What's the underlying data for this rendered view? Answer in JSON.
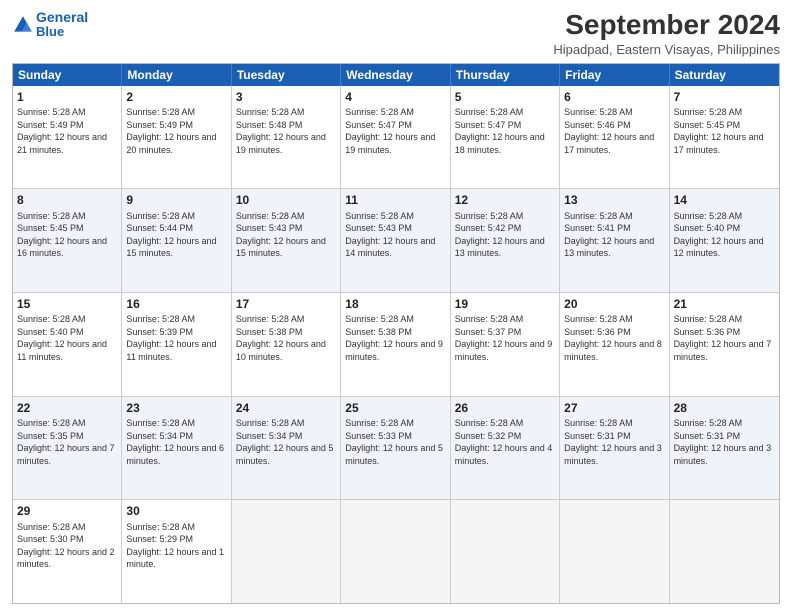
{
  "header": {
    "logo_general": "General",
    "logo_blue": "Blue",
    "title": "September 2024",
    "subtitle": "Hipadpad, Eastern Visayas, Philippines"
  },
  "calendar": {
    "headers": [
      "Sunday",
      "Monday",
      "Tuesday",
      "Wednesday",
      "Thursday",
      "Friday",
      "Saturday"
    ],
    "rows": [
      [
        {
          "day": "1",
          "sunrise": "5:28 AM",
          "sunset": "5:49 PM",
          "daylight": "12 hours and 21 minutes."
        },
        {
          "day": "2",
          "sunrise": "5:28 AM",
          "sunset": "5:49 PM",
          "daylight": "12 hours and 20 minutes."
        },
        {
          "day": "3",
          "sunrise": "5:28 AM",
          "sunset": "5:48 PM",
          "daylight": "12 hours and 19 minutes."
        },
        {
          "day": "4",
          "sunrise": "5:28 AM",
          "sunset": "5:47 PM",
          "daylight": "12 hours and 19 minutes."
        },
        {
          "day": "5",
          "sunrise": "5:28 AM",
          "sunset": "5:47 PM",
          "daylight": "12 hours and 18 minutes."
        },
        {
          "day": "6",
          "sunrise": "5:28 AM",
          "sunset": "5:46 PM",
          "daylight": "12 hours and 17 minutes."
        },
        {
          "day": "7",
          "sunrise": "5:28 AM",
          "sunset": "5:45 PM",
          "daylight": "12 hours and 17 minutes."
        }
      ],
      [
        {
          "day": "8",
          "sunrise": "5:28 AM",
          "sunset": "5:45 PM",
          "daylight": "12 hours and 16 minutes."
        },
        {
          "day": "9",
          "sunrise": "5:28 AM",
          "sunset": "5:44 PM",
          "daylight": "12 hours and 15 minutes."
        },
        {
          "day": "10",
          "sunrise": "5:28 AM",
          "sunset": "5:43 PM",
          "daylight": "12 hours and 15 minutes."
        },
        {
          "day": "11",
          "sunrise": "5:28 AM",
          "sunset": "5:43 PM",
          "daylight": "12 hours and 14 minutes."
        },
        {
          "day": "12",
          "sunrise": "5:28 AM",
          "sunset": "5:42 PM",
          "daylight": "12 hours and 13 minutes."
        },
        {
          "day": "13",
          "sunrise": "5:28 AM",
          "sunset": "5:41 PM",
          "daylight": "12 hours and 13 minutes."
        },
        {
          "day": "14",
          "sunrise": "5:28 AM",
          "sunset": "5:40 PM",
          "daylight": "12 hours and 12 minutes."
        }
      ],
      [
        {
          "day": "15",
          "sunrise": "5:28 AM",
          "sunset": "5:40 PM",
          "daylight": "12 hours and 11 minutes."
        },
        {
          "day": "16",
          "sunrise": "5:28 AM",
          "sunset": "5:39 PM",
          "daylight": "12 hours and 11 minutes."
        },
        {
          "day": "17",
          "sunrise": "5:28 AM",
          "sunset": "5:38 PM",
          "daylight": "12 hours and 10 minutes."
        },
        {
          "day": "18",
          "sunrise": "5:28 AM",
          "sunset": "5:38 PM",
          "daylight": "12 hours and 9 minutes."
        },
        {
          "day": "19",
          "sunrise": "5:28 AM",
          "sunset": "5:37 PM",
          "daylight": "12 hours and 9 minutes."
        },
        {
          "day": "20",
          "sunrise": "5:28 AM",
          "sunset": "5:36 PM",
          "daylight": "12 hours and 8 minutes."
        },
        {
          "day": "21",
          "sunrise": "5:28 AM",
          "sunset": "5:36 PM",
          "daylight": "12 hours and 7 minutes."
        }
      ],
      [
        {
          "day": "22",
          "sunrise": "5:28 AM",
          "sunset": "5:35 PM",
          "daylight": "12 hours and 7 minutes."
        },
        {
          "day": "23",
          "sunrise": "5:28 AM",
          "sunset": "5:34 PM",
          "daylight": "12 hours and 6 minutes."
        },
        {
          "day": "24",
          "sunrise": "5:28 AM",
          "sunset": "5:34 PM",
          "daylight": "12 hours and 5 minutes."
        },
        {
          "day": "25",
          "sunrise": "5:28 AM",
          "sunset": "5:33 PM",
          "daylight": "12 hours and 5 minutes."
        },
        {
          "day": "26",
          "sunrise": "5:28 AM",
          "sunset": "5:32 PM",
          "daylight": "12 hours and 4 minutes."
        },
        {
          "day": "27",
          "sunrise": "5:28 AM",
          "sunset": "5:31 PM",
          "daylight": "12 hours and 3 minutes."
        },
        {
          "day": "28",
          "sunrise": "5:28 AM",
          "sunset": "5:31 PM",
          "daylight": "12 hours and 3 minutes."
        }
      ],
      [
        {
          "day": "29",
          "sunrise": "5:28 AM",
          "sunset": "5:30 PM",
          "daylight": "12 hours and 2 minutes."
        },
        {
          "day": "30",
          "sunrise": "5:28 AM",
          "sunset": "5:29 PM",
          "daylight": "12 hours and 1 minute."
        },
        null,
        null,
        null,
        null,
        null
      ]
    ]
  }
}
